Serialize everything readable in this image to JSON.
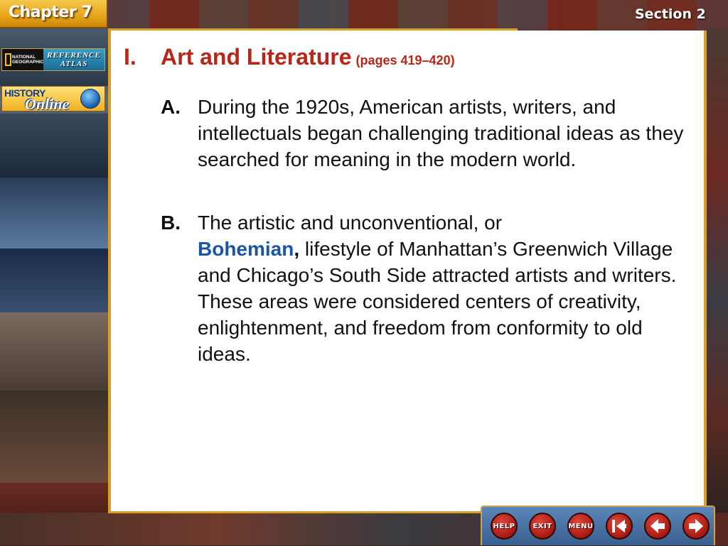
{
  "header": {
    "chapter_label": "Chapter 7",
    "section_label": "Section 2"
  },
  "sidebar": {
    "reference_atlas": {
      "publisher_text": "NATIONAL GEOGRAPHIC",
      "label": "REFERENCE ATLAS"
    },
    "history_online": {
      "label_top": "HISTORY",
      "label_bottom": "Online"
    }
  },
  "main": {
    "heading": {
      "number": "I.",
      "title": "Art and Literature",
      "pages": "(pages 419–420)"
    },
    "items": [
      {
        "letter": "A.",
        "text": "During the 1920s, American artists, writers, and intellectuals began challenging traditional ideas as they searched for meaning in the modern world."
      },
      {
        "letter": "B.",
        "text_before": "The artistic and unconventional, or",
        "term": "Bohemian",
        "term_punct": ",",
        "text_after": "lifestyle of Manhattan’s Greenwich Village and Chicago’s South Side attracted artists and writers. These areas were considered centers of creativity, enlightenment, and freedom from conformity to old ideas."
      }
    ]
  },
  "navigation": {
    "help_label": "HELP",
    "exit_label": "EXIT",
    "menu_label": "MENU",
    "first_icon": "first-slide-icon",
    "prev_icon": "previous-slide-icon",
    "next_icon": "next-slide-icon"
  },
  "colors": {
    "heading_red": "#b8261a",
    "term_blue": "#1a56a8",
    "border_gold": "#d8a028",
    "nav_button_red": "#c42a1e"
  }
}
